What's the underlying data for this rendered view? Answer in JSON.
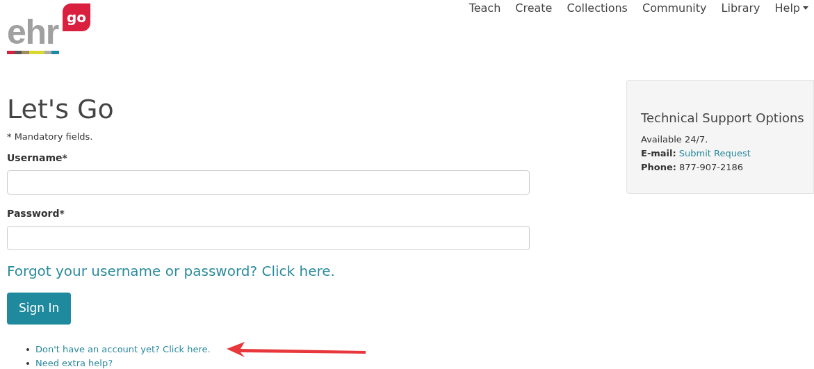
{
  "logo": {
    "word": "ehr",
    "badge": "go"
  },
  "nav": [
    {
      "label": "Teach",
      "dropdown": false
    },
    {
      "label": "Create",
      "dropdown": false
    },
    {
      "label": "Collections",
      "dropdown": false
    },
    {
      "label": "Community",
      "dropdown": false
    },
    {
      "label": "Library",
      "dropdown": false
    },
    {
      "label": "Help",
      "dropdown": true
    }
  ],
  "title": "Let's Go",
  "note": "* Mandatory fields.",
  "fields": [
    {
      "label": "Username*"
    },
    {
      "label": "Password*"
    }
  ],
  "forgot_link": "Forgot your username or password? Click here.",
  "sign_in": "Sign In",
  "links": [
    "Don't have an account yet? Click here.",
    "Need extra help?"
  ],
  "support": {
    "title": "Technical Support Options",
    "lines": [
      {
        "text": "Available 24/7.",
        "kind": "plain"
      },
      {
        "label": "E-mail:",
        "text": "Submit Request",
        "kind": "link"
      },
      {
        "label": "Phone:",
        "text": "877-907-2186",
        "kind": "plain"
      }
    ]
  }
}
